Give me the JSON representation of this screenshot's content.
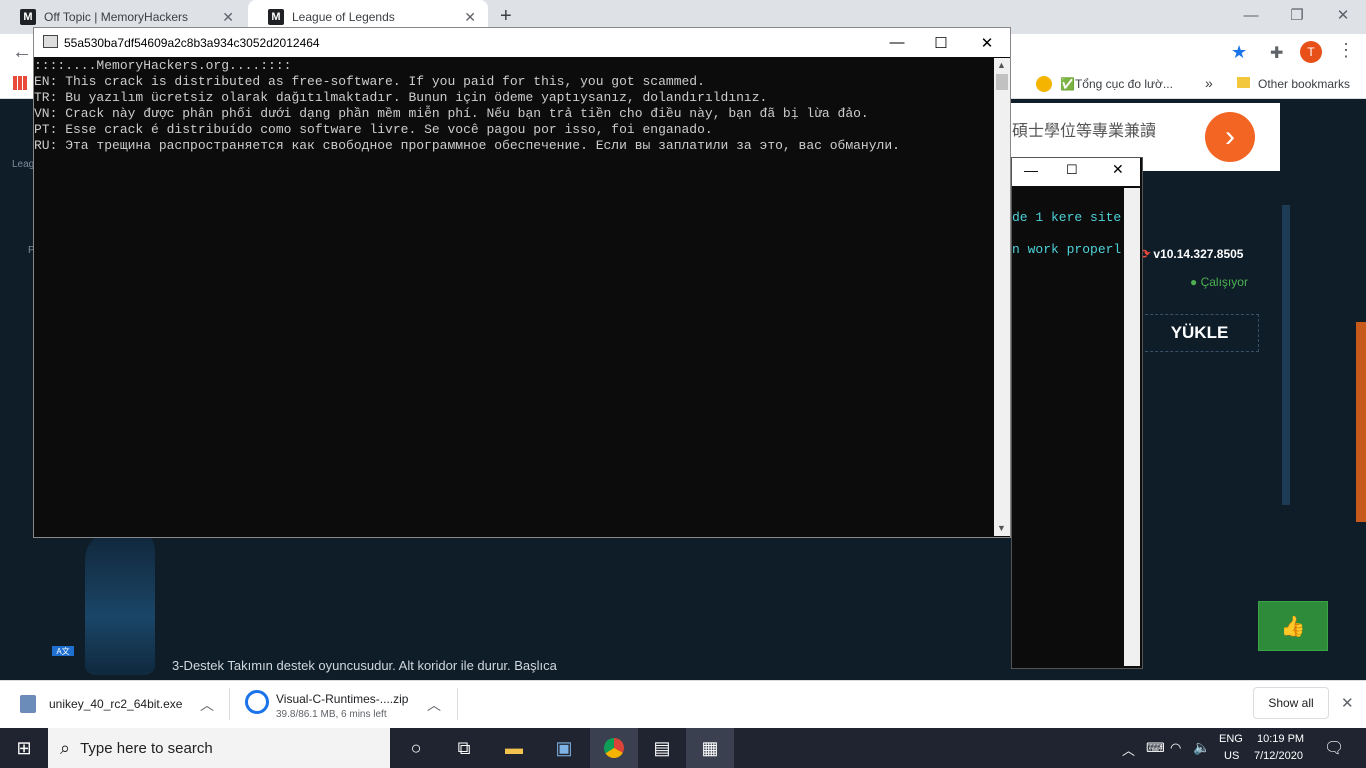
{
  "browser": {
    "tabs": [
      {
        "title": "Off Topic | MemoryHackers",
        "icon": "M"
      },
      {
        "title": "League of Legends",
        "icon": "M"
      }
    ],
    "new_tab": "+",
    "avatar": "T",
    "bookmarks": {
      "item1": "Tổng cục đo lườ...",
      "more": "»",
      "other": "Other bookmarks"
    }
  },
  "page": {
    "ad_text": "碩士學位等專業兼讀",
    "version": "v10.14.327.8505",
    "status": "Çalışıyor",
    "download_button": "YÜKLE",
    "bottom_text": "3-Destek Takımın destek oyuncusudur. Alt koridor ile durur. Başlıca",
    "left_text1": "Leag",
    "left_text2": "P",
    "lang_badge": "A文"
  },
  "console_main": {
    "title": "55a530ba7df54609a2c8b3a934c3052d2012464",
    "lines": [
      "::::....MemoryHackers.org....::::",
      "EN: This crack is distributed as free-software. If you paid for this, you got scammed.",
      "TR: Bu yazılım ücretsiz olarak dağıtılmaktadır. Bunun için ödeme yaptıysanız, dolandırıldınız.",
      "VN: Crack này được phân phối dưới dạng phần mềm miễn phí. Nếu bạn trả tiền cho điều này, bạn đã bị lừa đảo.",
      "PT: Esse crack é distribuído como software livre. Se você pagou por isso, foi enganado.",
      "RU: Эта трещина распространяется как свободное программное обеспечение. Если вы заплатили за это, вас обманули."
    ]
  },
  "console_second": {
    "lines": [
      "de 1 kere site",
      "n work properl"
    ]
  },
  "downloads": [
    {
      "name": "unikey_40_rc2_64bit.exe",
      "status": ""
    },
    {
      "name": "Visual-C-Runtimes-....zip",
      "status": "39.8/86.1 MB, 6 mins left"
    }
  ],
  "downloads_show_all": "Show all",
  "taskbar": {
    "search_placeholder": "Type here to search",
    "lang": "ENG",
    "region": "US",
    "time": "10:19 PM",
    "date": "7/12/2020"
  }
}
